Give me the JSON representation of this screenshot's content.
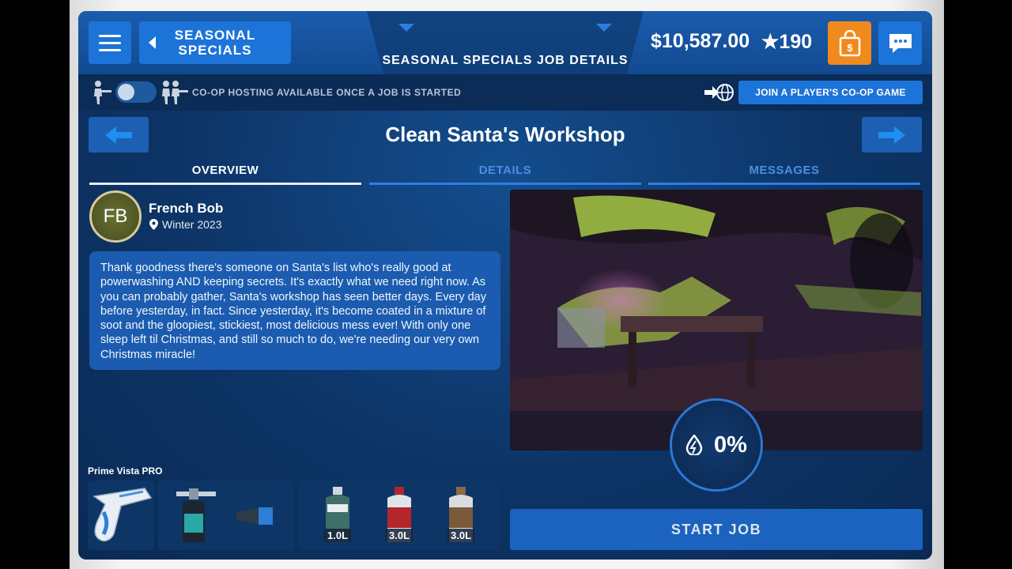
{
  "header": {
    "back_label": "SEASONAL SPECIALS",
    "title": "SEASONAL SPECIALS JOB DETAILS",
    "money": "$10,587.00",
    "stars": "★190",
    "icons": {
      "menu": "hamburger-menu-icon",
      "shop": "shopping-bag-icon",
      "chat": "chat-bubble-icon"
    }
  },
  "coop": {
    "notice": "CO-OP HOSTING AVAILABLE ONCE A JOB IS STARTED",
    "join_label": "JOIN A PLAYER'S CO-OP GAME",
    "toggle_on": false
  },
  "job": {
    "title": "Clean Santa's Workshop",
    "tabs": [
      {
        "label": "OVERVIEW",
        "active": true
      },
      {
        "label": "DETAILS",
        "active": false
      },
      {
        "label": "MESSAGES",
        "active": false
      }
    ],
    "client": {
      "initials": "FB",
      "name": "French Bob",
      "location": "Winter 2023"
    },
    "message": "Thank goodness there's someone on Santa's list who's really good at powerwashing AND keeping secrets. It's exactly what we need right now. As you can probably gather, Santa's workshop has seen better days. Every day before yesterday, in fact. Since yesterday, it's become coated in a mixture of soot and the gloopiest, stickiest, most delicious mess ever! With only one sleep left til Christmas, and still so much to do, we're needing our very own Christmas miracle!",
    "progress": "0%",
    "start_label": "START JOB"
  },
  "equipment": {
    "washer_name": "Prime Vista PRO",
    "soaps": [
      {
        "amount": "1.0L",
        "color": "#3f6f68"
      },
      {
        "amount": "3.0L",
        "color": "#b3262b"
      },
      {
        "amount": "3.0L",
        "color": "#7a5a3a"
      }
    ]
  },
  "colors": {
    "accent_blue": "#1d74d8",
    "shop_orange": "#f08a1c",
    "background": "#0d3466"
  }
}
